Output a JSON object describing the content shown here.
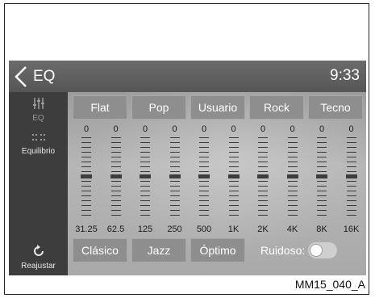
{
  "header": {
    "title": "EQ",
    "time": "9:33"
  },
  "sidebar": {
    "eq_label": "EQ",
    "balance_label": "Equilibrio",
    "reset_label": "Reajustar"
  },
  "presets": [
    "Flat",
    "Pop",
    "Usuario",
    "Rock",
    "Tecno"
  ],
  "bands": [
    {
      "freq": "31.25",
      "value": "0"
    },
    {
      "freq": "62.5",
      "value": "0"
    },
    {
      "freq": "125",
      "value": "0"
    },
    {
      "freq": "250",
      "value": "0"
    },
    {
      "freq": "500",
      "value": "0"
    },
    {
      "freq": "1K",
      "value": "0"
    },
    {
      "freq": "2K",
      "value": "0"
    },
    {
      "freq": "4K",
      "value": "0"
    },
    {
      "freq": "8K",
      "value": "0"
    },
    {
      "freq": "16K",
      "value": "0"
    }
  ],
  "bottom": {
    "classic_label": "Clásico",
    "jazz_label": "Jazz",
    "optimo_label": "Óptimo",
    "noise_label": "Ruidoso:",
    "noise_on": false
  },
  "caption": "MM15_040_A"
}
